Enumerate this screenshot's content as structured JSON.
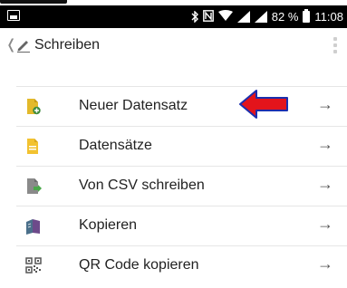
{
  "status_bar": {
    "battery_percent": "82 %",
    "time": "11:08",
    "icons": [
      "image-icon",
      "bluetooth-icon",
      "nfc-icon",
      "wifi-icon",
      "signal-icon",
      "battery-icon"
    ]
  },
  "app_bar": {
    "title": "Schreiben",
    "back_icon": "back-chevron-icon",
    "app_icon": "pen-icon",
    "menu_icon": "overflow-menu-icon"
  },
  "menu": {
    "items": [
      {
        "label": "Neuer Datensatz",
        "icon": "new-record-icon",
        "icon_color": "#e3b92a"
      },
      {
        "label": "Datensätze",
        "icon": "records-icon",
        "icon_color": "#f2c230"
      },
      {
        "label": "Von CSV schreiben",
        "icon": "csv-icon",
        "icon_color": "#4aa84a"
      },
      {
        "label": "Kopieren",
        "icon": "copy-icon",
        "icon_color": "#6d4a8a"
      },
      {
        "label": "QR Code kopieren",
        "icon": "qr-code-icon",
        "icon_color": "#555555"
      }
    ],
    "arrow_glyph": "→"
  },
  "annotation": {
    "arrow_color": "#e3141b",
    "arrow_outline": "#1b2fae"
  }
}
